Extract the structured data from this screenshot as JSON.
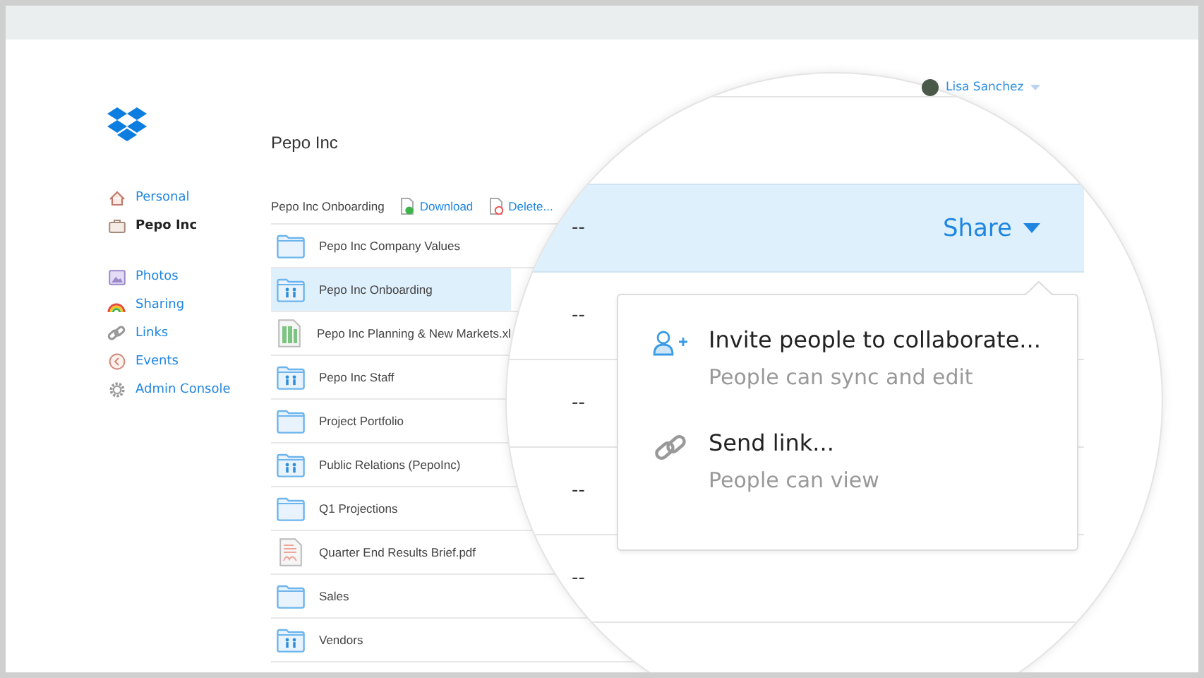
{
  "header": {
    "user": {
      "name": "Lisa Sanchez"
    }
  },
  "sidebar": {
    "teams": [
      {
        "kind": "home",
        "label": "Personal",
        "selected": false
      },
      {
        "kind": "team",
        "label": "Pepo Inc",
        "selected": true
      }
    ],
    "links": [
      {
        "kind": "photos",
        "label": "Photos"
      },
      {
        "kind": "sharing",
        "label": "Sharing"
      },
      {
        "kind": "links",
        "label": "Links"
      },
      {
        "kind": "events",
        "label": "Events"
      },
      {
        "kind": "admin",
        "label": "Admin Console"
      }
    ]
  },
  "page": {
    "title": "Pepo Inc"
  },
  "toolbar": {
    "path": "Pepo Inc Onboarding",
    "actions": [
      {
        "kind": "download",
        "label": "Download"
      },
      {
        "kind": "delete",
        "label": "Delete..."
      }
    ]
  },
  "files": [
    {
      "kind": "folder",
      "name": "Pepo Inc Company Values",
      "selected": false
    },
    {
      "kind": "shared",
      "name": "Pepo Inc Onboarding",
      "selected": true
    },
    {
      "kind": "sheet",
      "name": "Pepo Inc Planning & New Markets.xl",
      "selected": false
    },
    {
      "kind": "shared",
      "name": "Pepo Inc Staff",
      "selected": false
    },
    {
      "kind": "folder",
      "name": "Project Portfolio",
      "selected": false
    },
    {
      "kind": "shared",
      "name": "Public Relations (PepoInc)",
      "selected": false
    },
    {
      "kind": "folder",
      "name": "Q1 Projections",
      "selected": false
    },
    {
      "kind": "pdf",
      "name": "Quarter End Results Brief.pdf",
      "selected": false
    },
    {
      "kind": "folder",
      "name": "Sales",
      "selected": false
    },
    {
      "kind": "shared",
      "name": "Vendors",
      "selected": false
    }
  ],
  "magnifier": {
    "rows": [
      {
        "modified": "--",
        "selected": true,
        "action": "Share"
      },
      {
        "modified": "--",
        "selected": false
      },
      {
        "modified": "--",
        "selected": false
      },
      {
        "modified": "--",
        "selected": false
      },
      {
        "modified": "--",
        "selected": false
      }
    ],
    "menu": {
      "items": [
        {
          "kind": "invite",
          "title": "Invite people to collaborate...",
          "subtitle": "People can sync and edit"
        },
        {
          "kind": "link",
          "title": "Send link...",
          "subtitle": "People can view"
        }
      ]
    }
  }
}
